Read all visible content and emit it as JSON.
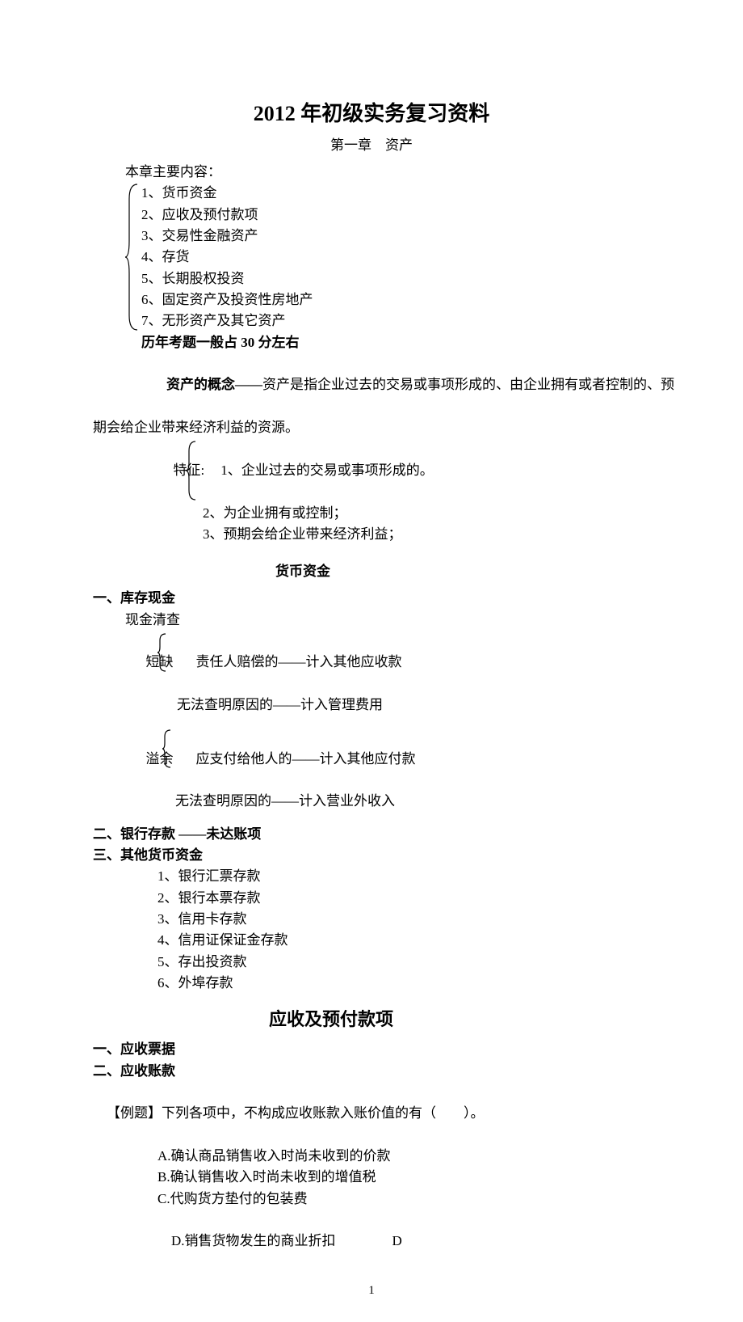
{
  "title": "2012 年初级实务复习资料",
  "chapter": "第一章　资产",
  "mainContentLabel": "本章主要内容：",
  "contents": [
    "1、货币资金",
    "2、应收及预付款项",
    "3、交易性金融资产",
    "4、存货",
    "5、长期股权投资",
    "6、固定资产及投资性房地产",
    "7、无形资产及其它资产"
  ],
  "examNote": "历年考题一般占 30 分左右",
  "assetDefLabel": "资产的概念——",
  "assetDefBody1": "资产是指企业过去的交易或事项形成的、由企业拥有或者控制的、预",
  "assetDefBody2": "期会给企业带来经济利益的资源。",
  "featureLabel": "特征:",
  "features": [
    "1、企业过去的交易或事项形成的。",
    "2、为企业拥有或控制；",
    "3、预期会给企业带来经济利益；"
  ],
  "moneySectionTitle": "货币资金",
  "cashHeading": "一、库存现金",
  "cashCheck": "现金清查",
  "shortLabel": "短缺",
  "shortItems": [
    "责任人赔偿的——计入其他应收款",
    "无法查明原因的——计入管理费用"
  ],
  "overLabel": "溢余",
  "overItems": [
    "应支付给他人的——计入其他应付款",
    "无法查明原因的——计入营业外收入"
  ],
  "bankHeading": "二、银行存款 ——未达账项",
  "otherHeading": "三、其他货币资金",
  "otherItems": [
    "1、银行汇票存款",
    "2、银行本票存款",
    "3、信用卡存款",
    "4、信用证保证金存款",
    "5、存出投资款",
    "6、外埠存款"
  ],
  "receivableTitle": "应收及预付款项",
  "recv1": "一、应收票据",
  "recv2": "二、应收账款",
  "exampleLabel": "【例题】",
  "exampleQ": "下列各项中，不构成应收账款入账价值的有（　　）。",
  "options": [
    "A.确认商品销售收入时尚未收到的价款",
    "B.确认销售收入时尚未收到的增值税",
    "C.代购货方垫付的包装费",
    "D.销售货物发生的商业折扣"
  ],
  "answer": "D",
  "pageNumber": "1"
}
